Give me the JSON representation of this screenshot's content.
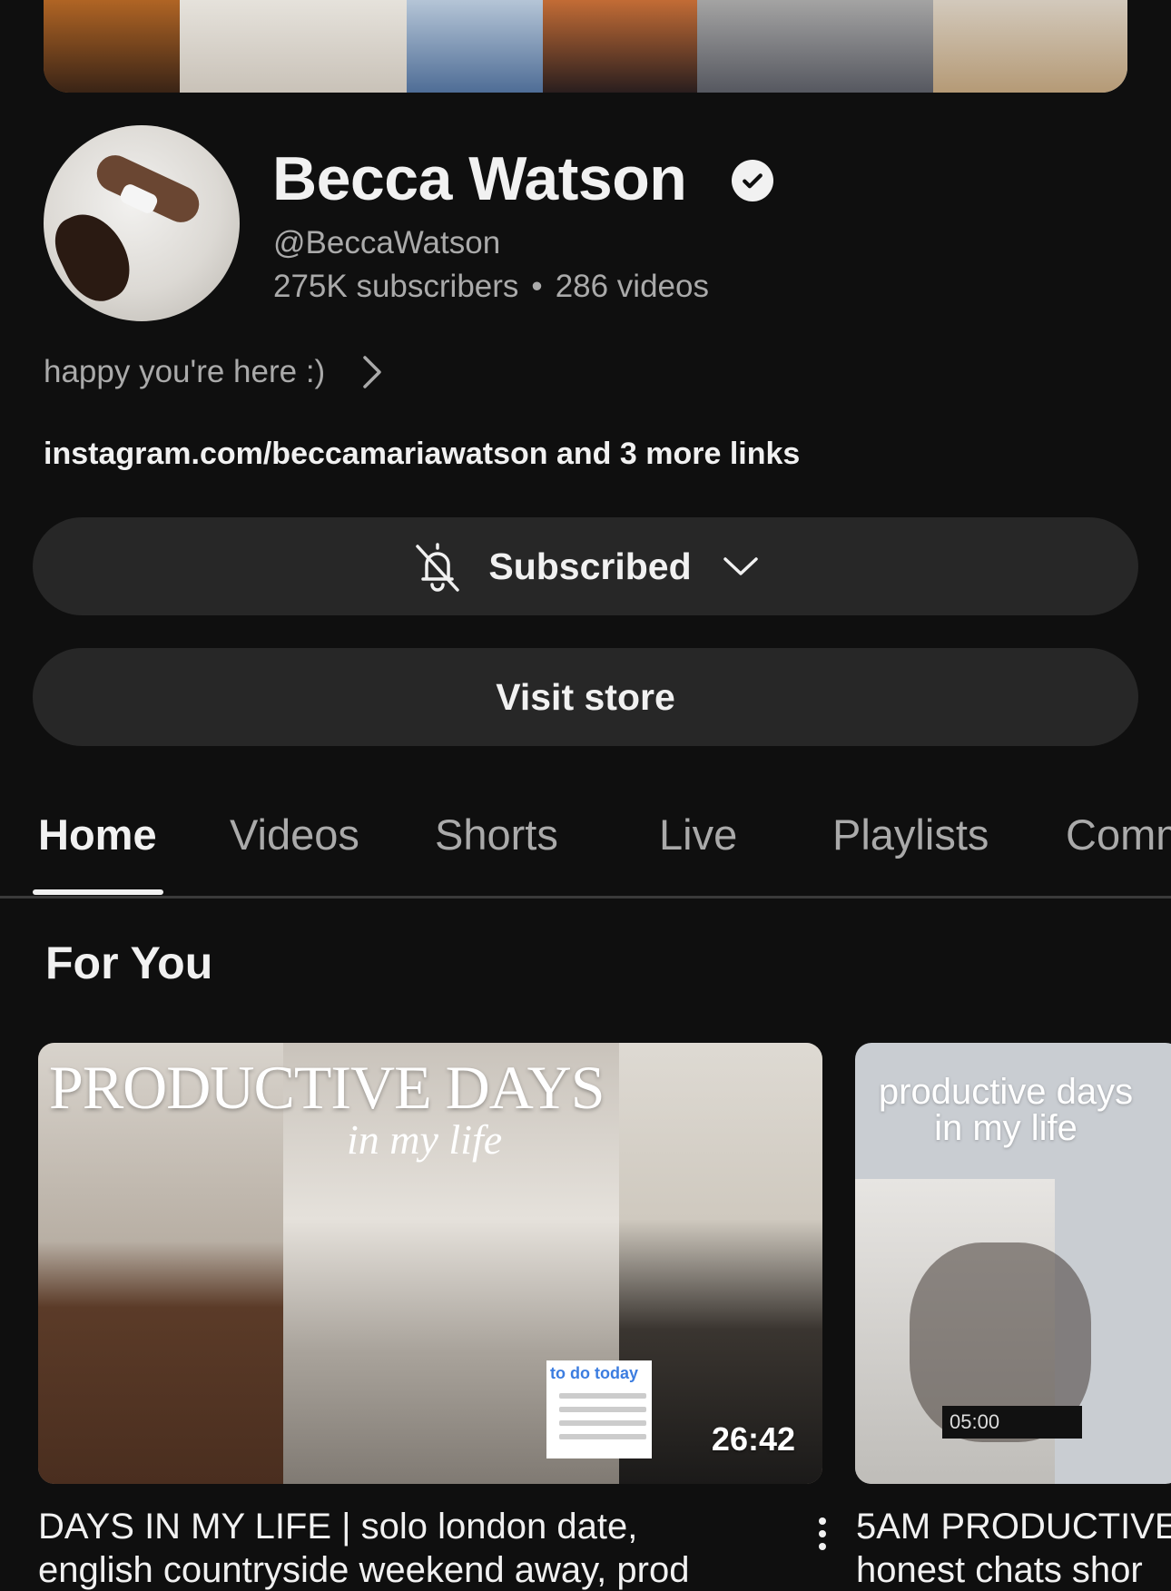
{
  "channel": {
    "name": "Becca Watson",
    "handle": "@BeccaWatson",
    "subscribers": "275K subscribers",
    "separator": "•",
    "videos": "286 videos",
    "description": "happy you're here :)",
    "links": "instagram.com/beccamariawatson and 3 more links"
  },
  "buttons": {
    "subscribed_label": "Subscribed",
    "store_label": "Visit store"
  },
  "tabs": [
    {
      "label": "Home"
    },
    {
      "label": "Videos"
    },
    {
      "label": "Shorts"
    },
    {
      "label": "Live"
    },
    {
      "label": "Playlists"
    },
    {
      "label": "Comm"
    }
  ],
  "active_tab": "Home",
  "section": {
    "title": "For You"
  },
  "videos": [
    {
      "thumb_title": "PRODUCTIVE DAYS",
      "thumb_subtitle": "in my life",
      "todo_title": "to do today",
      "duration": "26:42",
      "title_line1": "DAYS IN MY LIFE | solo london date,",
      "title_line2": "english countryside weekend away, prod"
    },
    {
      "thumb_title": "productive days in my life",
      "clock": "05:00",
      "title_line1": "5AM PRODUCTIVE",
      "title_line2": "honest chats shor"
    }
  ],
  "icons": {
    "verified": "verified-check-icon",
    "chevron": "chevron-right-icon",
    "bell": "bell-off-icon",
    "caret": "chevron-down-icon",
    "more": "more-vert-icon"
  },
  "colors": {
    "background": "#0f0f0f",
    "pill": "#272727",
    "text_primary": "#f1f1f1",
    "text_secondary": "#aaaaaa"
  }
}
